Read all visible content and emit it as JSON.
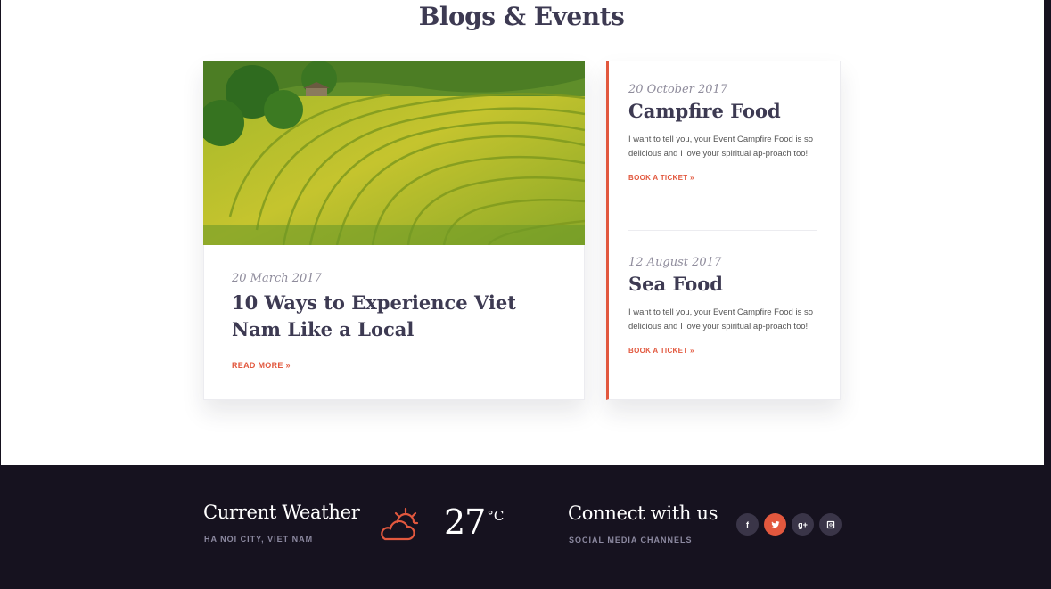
{
  "section": {
    "title": "Blogs & Events"
  },
  "blog": {
    "date": "20 March 2017",
    "title": "10 Ways to Experience Viet Nam Like a Local",
    "link": "READ MORE »",
    "image": "rice-terraces-photo"
  },
  "events": [
    {
      "date": "20 October 2017",
      "title": "Campfire Food",
      "description": "I want to tell you, your Event Campfire Food is so delicious and I love your spiritual ap-proach too!",
      "link": "BOOK A TICKET »"
    },
    {
      "date": "12 August 2017",
      "title": "Sea Food",
      "description": "I want to tell you, your Event Campfire Food is so delicious and I love your spiritual ap-proach too!",
      "link": "BOOK A TICKET »"
    }
  ],
  "footer": {
    "weather_title": "Current Weather",
    "weather_location": "HA NOI CITY, VIET NAM",
    "weather_icon": "partly-sunny-icon",
    "temperature": "27",
    "temperature_unit": "°C",
    "connect_title": "Connect with us",
    "connect_subtitle": "SOCIAL MEDIA CHANNELS",
    "socials": [
      {
        "icon": "facebook-icon",
        "glyph": "f",
        "active": false
      },
      {
        "icon": "twitter-icon",
        "glyph": "",
        "active": true
      },
      {
        "icon": "google-plus-icon",
        "glyph": "g+",
        "active": false
      },
      {
        "icon": "instagram-icon",
        "glyph": "",
        "active": false
      }
    ]
  },
  "colors": {
    "accent": "#e2583e",
    "heading": "#3d3a52",
    "footer_bg": "#16121f",
    "muted": "#8f8c9c"
  }
}
